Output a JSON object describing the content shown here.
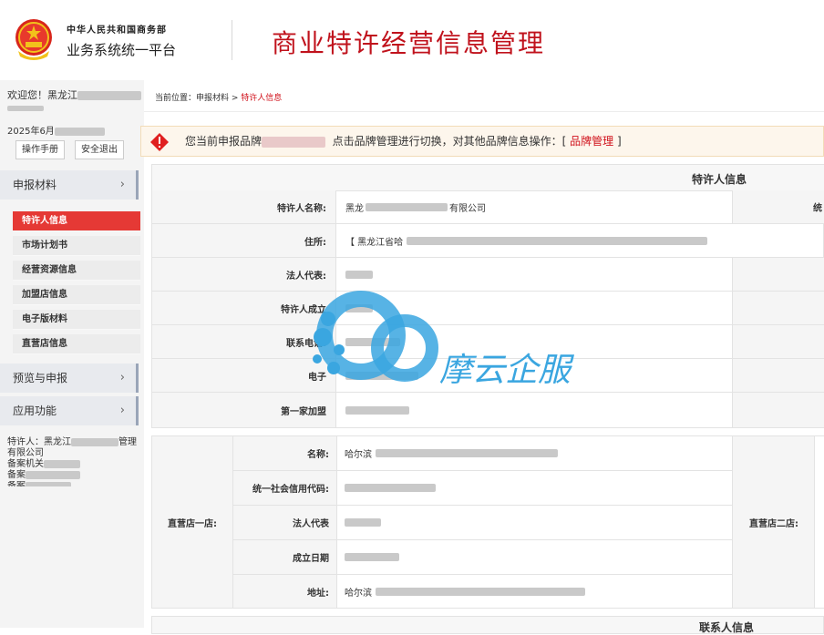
{
  "header": {
    "ministry": "中华人民共和国商务部",
    "platform": "业务系统统一平台",
    "title": "商业特许经营信息管理"
  },
  "sidebar": {
    "welcome_prefix": "欢迎您！黑龙江",
    "date_prefix": "2025年6月",
    "manual_button": "操作手册",
    "logout_button": "安全退出",
    "menus": [
      {
        "label": "申报材料",
        "chevron": "›"
      },
      {
        "label": "预览与申报",
        "chevron": "›"
      },
      {
        "label": "应用功能",
        "chevron": "›"
      }
    ],
    "submenu": [
      "特许人信息",
      "市场计划书",
      "经营资源信息",
      "加盟店信息",
      "电子版材料",
      "直营店信息"
    ],
    "info": {
      "franchisor_prefix": "特许人：黑龙江",
      "franchisor_suffix": "管理",
      "franchisor_line2": "有限公司",
      "record_org": "备案机关",
      "record_no": "备案",
      "record_status": "备案"
    }
  },
  "main": {
    "crumb_prefix": "当前位置：申报材料 > ",
    "crumb_current": "特许人信息",
    "notice_prefix": "您当前申报品牌",
    "notice_mid": "点击品牌管理进行切换，对其他品牌信息操作：[",
    "notice_link": "品牌管理",
    "notice_suffix": "]",
    "section_title": "特许人信息",
    "rows": [
      {
        "label": "特许人名称:",
        "value_prefix": "黑龙",
        "value_suffix": "有限公司",
        "right": "统"
      },
      {
        "label": "住所:",
        "value_prefix": "【 黑龙江省哈",
        "value_suffix": "",
        "right": ""
      },
      {
        "label": "法人代表:",
        "value_prefix": "",
        "value_suffix": "",
        "right": ""
      },
      {
        "label": "特许人成立",
        "value_prefix": "",
        "value_suffix": "",
        "right": ""
      },
      {
        "label": "联系电话:",
        "value_prefix": "",
        "value_suffix": "",
        "right": ""
      },
      {
        "label": "电子",
        "value_prefix": "",
        "value_suffix": "",
        "right": ""
      },
      {
        "label": "第一家加盟",
        "value_prefix": "",
        "value_suffix": "",
        "right": ""
      }
    ],
    "store1_label": "直营店一店:",
    "store2_label": "直营店二店:",
    "store_rows": [
      {
        "label": "名称:",
        "value": "哈尔滨"
      },
      {
        "label": "统一社会信用代码:",
        "value": ""
      },
      {
        "label": "法人代表",
        "value": ""
      },
      {
        "label": "成立日期",
        "value": ""
      },
      {
        "label": "地址:",
        "value": "哈尔滨"
      }
    ],
    "contact_title": "联系人信息"
  },
  "watermark": {
    "text": "摩云企服",
    "color": "#3aa6e0"
  },
  "colors": {
    "accent": "#c0121c",
    "active_menu": "#e53935"
  }
}
